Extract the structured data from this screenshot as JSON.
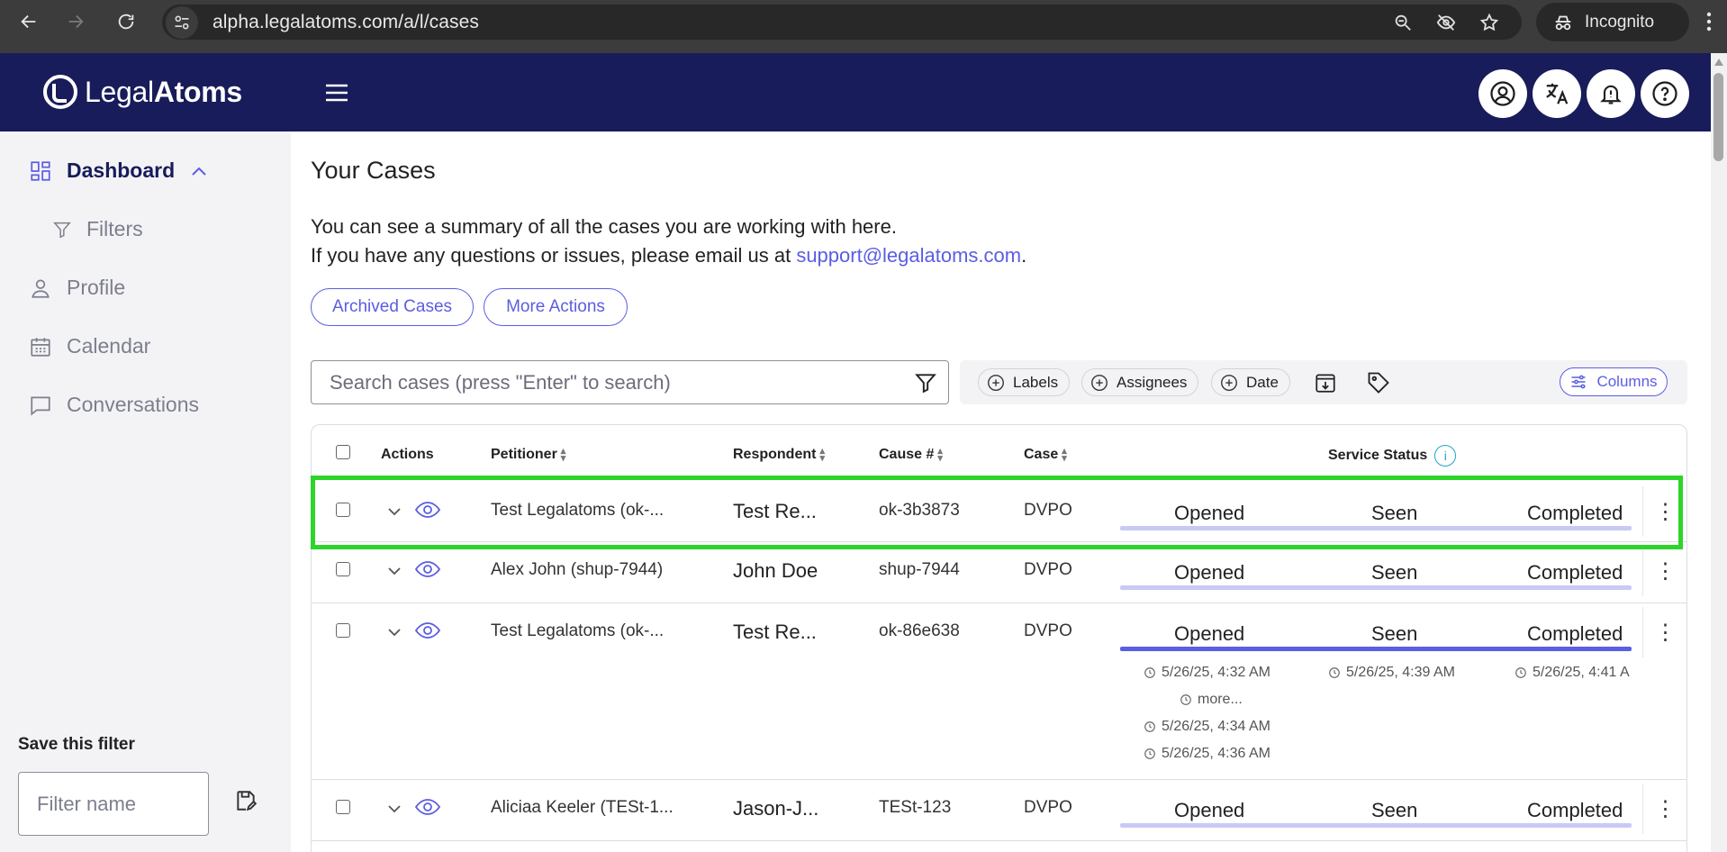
{
  "browser": {
    "url": "alpha.legalatoms.com/a/l/cases",
    "profile_label": "Incognito",
    "icons": [
      "back-arrow-icon",
      "forward-arrow-icon",
      "reload-icon",
      "site-info-icon",
      "zoom-icon",
      "eye-off-icon",
      "star-icon",
      "incognito-icon",
      "kebab-icon"
    ]
  },
  "header": {
    "logo_light": "Legal",
    "logo_bold": "Atoms",
    "buttons": [
      "account-icon",
      "translate-icon",
      "notifications-icon",
      "help-icon"
    ]
  },
  "sidebar": {
    "items": [
      {
        "label": "Dashboard",
        "icon": "dashboard-grid-icon"
      },
      {
        "label": "Filters",
        "icon": "filter-icon"
      },
      {
        "label": "Profile",
        "icon": "person-icon"
      },
      {
        "label": "Calendar",
        "icon": "calendar-icon"
      },
      {
        "label": "Conversations",
        "icon": "chat-icon"
      }
    ],
    "save_filter_label": "Save this filter",
    "filter_name_placeholder": "Filter name"
  },
  "main": {
    "title": "Your Cases",
    "intro_line1": "You can see a summary of all the cases you are working with here.",
    "intro_line2_prefix": "If you have any questions or issues, please email us at ",
    "support_email": "support@legalatoms.com",
    "intro_line2_suffix": ".",
    "archived_button": "Archived Cases",
    "more_actions_button": "More Actions",
    "search_placeholder": "Search cases (press \"Enter\" to search)",
    "chips": {
      "labels": "Labels",
      "assignees": "Assignees",
      "date": "Date"
    },
    "columns_button": "Columns"
  },
  "table": {
    "headers": {
      "actions": "Actions",
      "petitioner": "Petitioner",
      "respondent": "Respondent",
      "cause": "Cause #",
      "case": "Case",
      "service_status": "Service Status"
    },
    "status_labels": {
      "opened": "Opened",
      "seen": "Seen",
      "completed": "Completed"
    },
    "rows": [
      {
        "petitioner": "Test Legalatoms (ok-...",
        "respondent": "Test Re...",
        "cause": "ok-3b3873",
        "case": "DVPO"
      },
      {
        "petitioner": "Alex John (shup-7944)",
        "respondent": "John Doe",
        "cause": "shup-7944",
        "case": "DVPO"
      },
      {
        "petitioner": "Test Legalatoms (ok-...",
        "respondent": "Test Re...",
        "cause": "ok-86e638",
        "case": "DVPO",
        "timestamps": {
          "opened": "5/26/25, 4:32 AM",
          "seen": "5/26/25, 4:39 AM",
          "completed": "5/26/25, 4:41 A",
          "more": "more...",
          "extra1": "5/26/25, 4:34 AM",
          "extra2": "5/26/25, 4:36 AM"
        }
      },
      {
        "petitioner": "Aliciaa Keeler (TESt-1...",
        "respondent": "Jason-J...",
        "cause": "TESt-123",
        "case": "DVPO"
      }
    ],
    "row_menu": "⋮"
  }
}
